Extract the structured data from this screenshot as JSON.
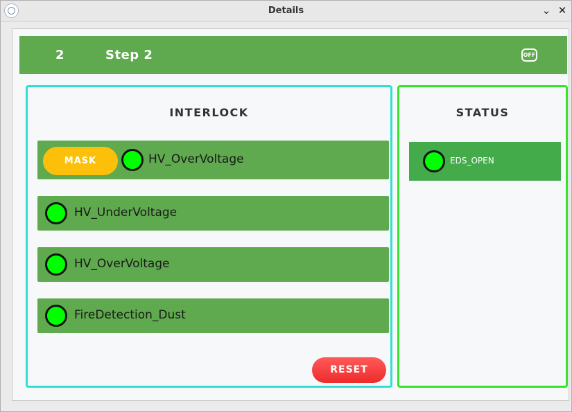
{
  "window": {
    "title": "Details",
    "minimize_glyph": "⌄",
    "close_glyph": "✕"
  },
  "header": {
    "step_number": "2",
    "step_name": "Step 2",
    "off_button": "OFF",
    "background": "#5faa4e"
  },
  "interlock": {
    "title": "INTERLOCK",
    "border_color": "#2fe0d0",
    "mask_label": "MASK",
    "items": [
      {
        "label": "HV_OverVoltage",
        "led_color": "#00ff00",
        "masked_button": true
      },
      {
        "label": "HV_UnderVoltage",
        "led_color": "#00ff00"
      },
      {
        "label": "HV_OverVoltage",
        "led_color": "#00ff00"
      },
      {
        "label": "FireDetection_Dust",
        "led_color": "#00ff00"
      }
    ],
    "reset_label": "RESET"
  },
  "status": {
    "title": "STATUS",
    "border_color": "#37e32c",
    "items": [
      {
        "label": "EDS_OPEN",
        "led_color": "#00ff00"
      }
    ]
  },
  "icons": {
    "app": "app-logo-icon",
    "led": "status-led-icon",
    "power": "power-off-icon"
  }
}
